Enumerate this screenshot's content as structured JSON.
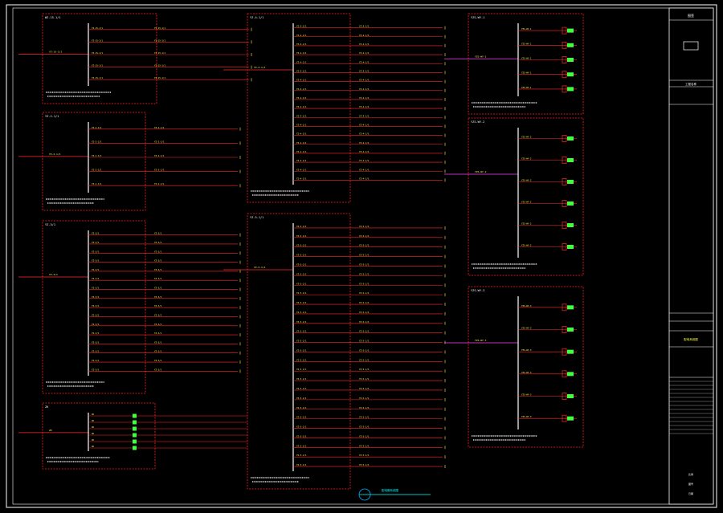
{
  "colors": {
    "frame": "#ffffff",
    "box": "#ff2020",
    "wire": "#ff2a2a",
    "text": "#ffff40",
    "label": "#ffffff",
    "feed": "#ff40ff",
    "terminal": "#40ff40",
    "accent": "#00ffff",
    "tbBg": "#000000"
  },
  "panels": [
    {
      "id": "p1",
      "title": "WZ-15-1/1",
      "code": "YZ-15-1/1",
      "circuits": 5
    },
    {
      "id": "p2",
      "title": "YZ-2-1/1",
      "code": "YZ-2-1/1",
      "circuits": 5
    },
    {
      "id": "p3",
      "title": "YZ-3/1",
      "code": "YZ-3/1",
      "circuits": 16
    },
    {
      "id": "p4",
      "title": "ZK",
      "code": "ZK",
      "circuits": 6
    },
    {
      "id": "p5",
      "title": "YZ-4-1/1",
      "code": "YZ-4-1/1",
      "circuits": 18
    },
    {
      "id": "p6",
      "title": "YZ-5-1/1",
      "code": "YZ-5-1/1",
      "circuits": 26
    },
    {
      "id": "p7",
      "title": "YZS-WY-1",
      "code": "YZS-WY-1",
      "circuits": 5
    },
    {
      "id": "p8",
      "title": "YZS-WY-2",
      "code": "YZS-WY-2",
      "circuits": 6
    },
    {
      "id": "p9",
      "title": "YZS-WY-3",
      "code": "YZS-WY-3",
      "circuits": 6
    }
  ],
  "titleblock": {
    "header": "图签",
    "project": "工程名称",
    "drawing": "配电系统图",
    "scale": "比例",
    "sheet": "图号",
    "date": "日期"
  },
  "legend": {
    "label": "配电箱系统图"
  }
}
